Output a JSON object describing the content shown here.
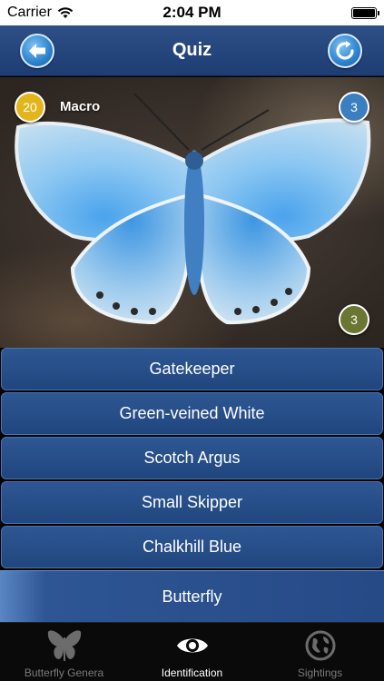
{
  "status_bar": {
    "carrier": "Carrier",
    "time": "2:04 PM"
  },
  "nav": {
    "title": "Quiz"
  },
  "photo": {
    "score_badge": "20",
    "mode_label": "Macro",
    "top_right_badge": "3",
    "bottom_right_badge": "3"
  },
  "options": [
    {
      "label": "Gatekeeper"
    },
    {
      "label": "Green-veined White"
    },
    {
      "label": "Scotch Argus"
    },
    {
      "label": "Small Skipper"
    },
    {
      "label": "Chalkhill Blue"
    }
  ],
  "category": {
    "label": "Butterfly"
  },
  "tabs": [
    {
      "label": "Butterfly Genera",
      "icon": "butterfly-icon",
      "active": false
    },
    {
      "label": "Identification",
      "icon": "eye-icon",
      "active": true
    },
    {
      "label": "Sightings",
      "icon": "globe-icon",
      "active": false
    }
  ],
  "colors": {
    "nav": "#1d3d73",
    "option": "#21467e",
    "badge_gold": "#e3b51d",
    "badge_blue": "#3c7fc0",
    "badge_olive": "#6a7632"
  }
}
